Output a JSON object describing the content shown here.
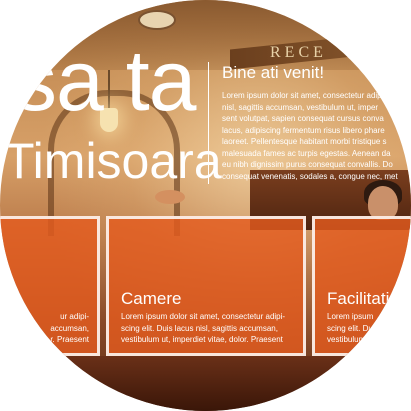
{
  "hero": {
    "title": "sa ta",
    "subtitle": "Timisoara"
  },
  "background": {
    "sign_text": "RECE"
  },
  "welcome": {
    "title": "Bine ati venit!",
    "lines": [
      "Lorem ipsum dolor sit amet, consectetur adip",
      "nisl, sagittis accumsan, vestibulum ut, imper",
      "sent volutpat, sapien consequat cursus conva",
      "lacus, adipiscing fermentum risus libero phare",
      "laoreet. Pellentesque habitant morbi tristique s",
      "malesuada fames ac turpis egestas. Aenean da",
      "eu nibh dignissim purus consequat convallis. Do",
      "consequat venenatis, sodales a, congue nec, met"
    ]
  },
  "panels": [
    {
      "title": "",
      "lines": [
        "ur adipi-",
        "accumsan,",
        "r. Praesent"
      ]
    },
    {
      "title": "Camere",
      "lines": [
        "Lorem ipsum dolor sit amet, consectetur adipi-",
        "scing elit. Duis lacus nisl, sagittis accumsan,",
        "vestibulum ut, imperdiet vitae, dolor. Praesent"
      ]
    },
    {
      "title": "Facilitati",
      "lines": [
        "Lorem ipsum",
        "scing elit. Du",
        "vestibulum ut"
      ]
    }
  ],
  "colors": {
    "panel_orange": "#e45c1e",
    "text": "#ffffff"
  }
}
